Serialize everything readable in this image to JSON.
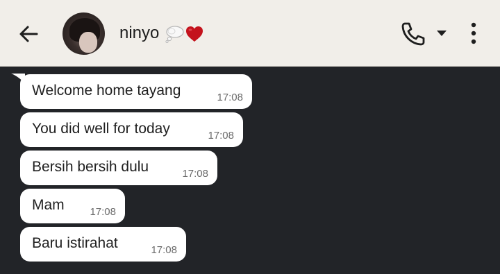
{
  "header": {
    "contact_name": "ninyo",
    "emojis": [
      "thought-balloon",
      "red-heart"
    ],
    "icons": [
      "back-arrow-icon",
      "phone-icon",
      "caret-down-icon",
      "more-vertical-icon"
    ]
  },
  "messages": [
    {
      "text": "Welcome home tayang",
      "time": "17:08"
    },
    {
      "text": "You did well for today",
      "time": "17:08"
    },
    {
      "text": "Bersih bersih dulu",
      "time": "17:08"
    },
    {
      "text": "Mam",
      "time": "17:08"
    },
    {
      "text": "Baru istirahat",
      "time": "17:08"
    }
  ],
  "colors": {
    "header_bg": "#f1eee9",
    "chat_bg": "#222428",
    "bubble_bg": "#ffffff",
    "heart": "#c4121c"
  }
}
